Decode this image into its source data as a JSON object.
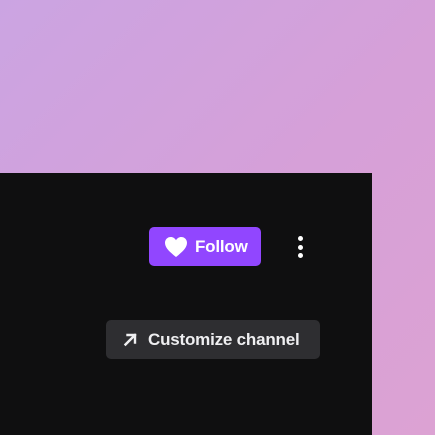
{
  "colors": {
    "accent": "#9146ff",
    "panel_background": "#0f0f10",
    "secondary_button": "#2e2e31",
    "text_light": "#ffffff"
  },
  "channel_actions": {
    "follow": {
      "label": "Follow",
      "icon": "heart-icon"
    },
    "more_options": {
      "icon": "vertical-ellipsis-icon"
    },
    "customize": {
      "label": "Customize channel",
      "icon": "arrow-up-right-icon"
    }
  }
}
